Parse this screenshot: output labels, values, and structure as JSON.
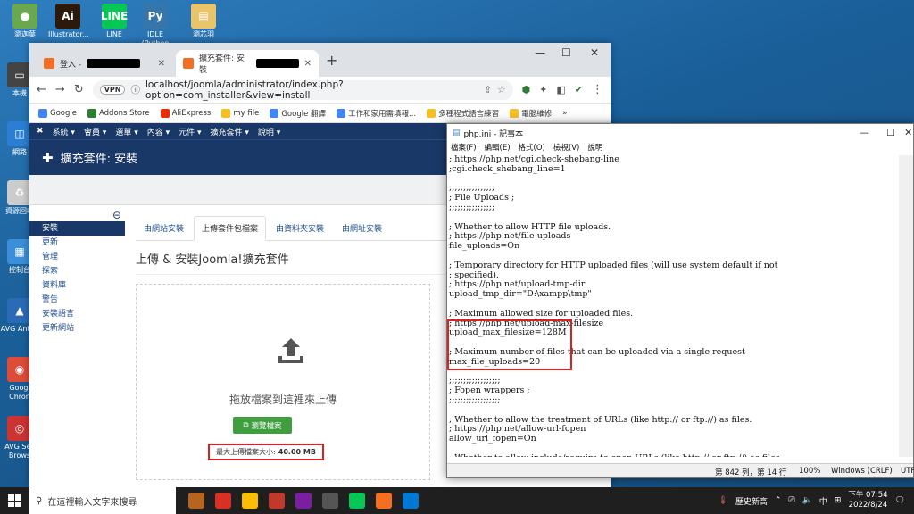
{
  "desktop": {
    "icons": [
      {
        "label": "瀏迦葉",
        "color": "#6aa84f",
        "glyph": "●"
      },
      {
        "label": "Illustrator...",
        "color": "#2b1a0b",
        "glyph": "Ai"
      },
      {
        "label": "LINE",
        "color": "#06c755",
        "glyph": "LINE"
      },
      {
        "label": "IDLE (Python",
        "color": "#3776ab",
        "glyph": "Py"
      },
      {
        "label": "瀏芯羽",
        "color": "#e9c46a",
        "glyph": "▤"
      }
    ],
    "side_icons": [
      {
        "label": "本機",
        "color": "#444",
        "glyph": "▭"
      },
      {
        "label": "網路",
        "color": "#2a7fd4",
        "glyph": "◫"
      },
      {
        "label": "資源回收",
        "color": "#ccc",
        "glyph": "♻"
      },
      {
        "label": "控制台",
        "color": "#3a8fd8",
        "glyph": "▦"
      },
      {
        "label": "AVG AntiVi",
        "color": "#2b6bb5",
        "glyph": "▲"
      },
      {
        "label": "Googl Chron",
        "color": "#dd4b39",
        "glyph": "◉"
      },
      {
        "label": "AVG Sec Brows",
        "color": "#c33",
        "glyph": "◎"
      }
    ]
  },
  "browser": {
    "tabs": [
      {
        "label": "登入 -"
      },
      {
        "label": "擴充套件: 安裝"
      }
    ],
    "url": "localhost/joomla/administrator/index.php?option=com_installer&view=install",
    "vpn_label": "VPN",
    "bookmarks": [
      {
        "label": "Google",
        "color": "#4285f4"
      },
      {
        "label": "Addons Store",
        "color": "#2e7d32"
      },
      {
        "label": "AliExpress",
        "color": "#e62e04"
      },
      {
        "label": "my file",
        "color": "#f6bf26"
      },
      {
        "label": "Google 翻譯",
        "color": "#4285f4"
      },
      {
        "label": "工作和家用需填報...",
        "color": "#4285f4"
      },
      {
        "label": "多種程式語言練習",
        "color": "#f6bf26"
      },
      {
        "label": "電腦維修",
        "color": "#f6bf26"
      }
    ]
  },
  "joomla": {
    "nav": [
      "系統 ▾",
      "會員 ▾",
      "選單 ▾",
      "內容 ▾",
      "元件 ▾",
      "擴充套件 ▾",
      "說明 ▾"
    ],
    "header_title": "擴充套件: 安裝",
    "sidebar": [
      "安裝",
      "更新",
      "管理",
      "探索",
      "資料庫",
      "警告",
      "安裝語言",
      "更新網站"
    ],
    "tabs": [
      "由網站安裝",
      "上傳套件包檔案",
      "由資料夾安裝",
      "由網址安裝"
    ],
    "page_title": "上傳 & 安裝Joomla!擴充套件",
    "dropzone_text": "拖放檔案到這裡來上傳",
    "browse_label": "瀏覽檔案",
    "max_size_label": "最大上傳檔案大小:",
    "max_size_value": "40.00 MB"
  },
  "notepad": {
    "title": "php.ini - 記事本",
    "menu": [
      "檔案(F)",
      "編輯(E)",
      "格式(O)",
      "檢視(V)",
      "說明"
    ],
    "lines": [
      "; https://php.net/cgi.check-shebang-line",
      ";cgi.check_shebang_line=1",
      "",
      ";;;;;;;;;;;;;;;;",
      "; File Uploads ;",
      ";;;;;;;;;;;;;;;;",
      "",
      "; Whether to allow HTTP file uploads.",
      "; https://php.net/file-uploads",
      "file_uploads=On",
      "",
      "; Temporary directory for HTTP uploaded files (will use system default if not",
      "; specified).",
      "; https://php.net/upload-tmp-dir",
      "upload_tmp_dir=\"D:\\xampp\\tmp\"",
      "",
      "; Maximum allowed size for uploaded files.",
      "; https://php.net/upload-max-filesize",
      "upload_max_filesize=128M",
      "",
      "; Maximum number of files that can be uploaded via a single request",
      "max_file_uploads=20",
      "",
      ";;;;;;;;;;;;;;;;;;",
      "; Fopen wrappers ;",
      ";;;;;;;;;;;;;;;;;;",
      "",
      "; Whether to allow the treatment of URLs (like http:// or ftp://) as files.",
      "; https://php.net/allow-url-fopen",
      "allow_url_fopen=On",
      "",
      "; Whether to allow include/require to open URLs (like http:// or ftp://) as files."
    ],
    "status": {
      "position": "第 842 列，第 14 行",
      "zoom": "100%",
      "eol": "Windows (CRLF)",
      "encoding": "UTF"
    }
  },
  "taskbar": {
    "search_placeholder": "在這裡輸入文字來搜尋",
    "apps": [
      "#b5651d",
      "#d93025",
      "#fbbc04",
      "#c0392b",
      "#7b1fa2",
      "#555",
      "#06c755",
      "#f36f21",
      "#0078d4"
    ],
    "news_label": "歷史新高",
    "ime": "中",
    "time": "下午 07:54",
    "date": "2022/8/24"
  }
}
